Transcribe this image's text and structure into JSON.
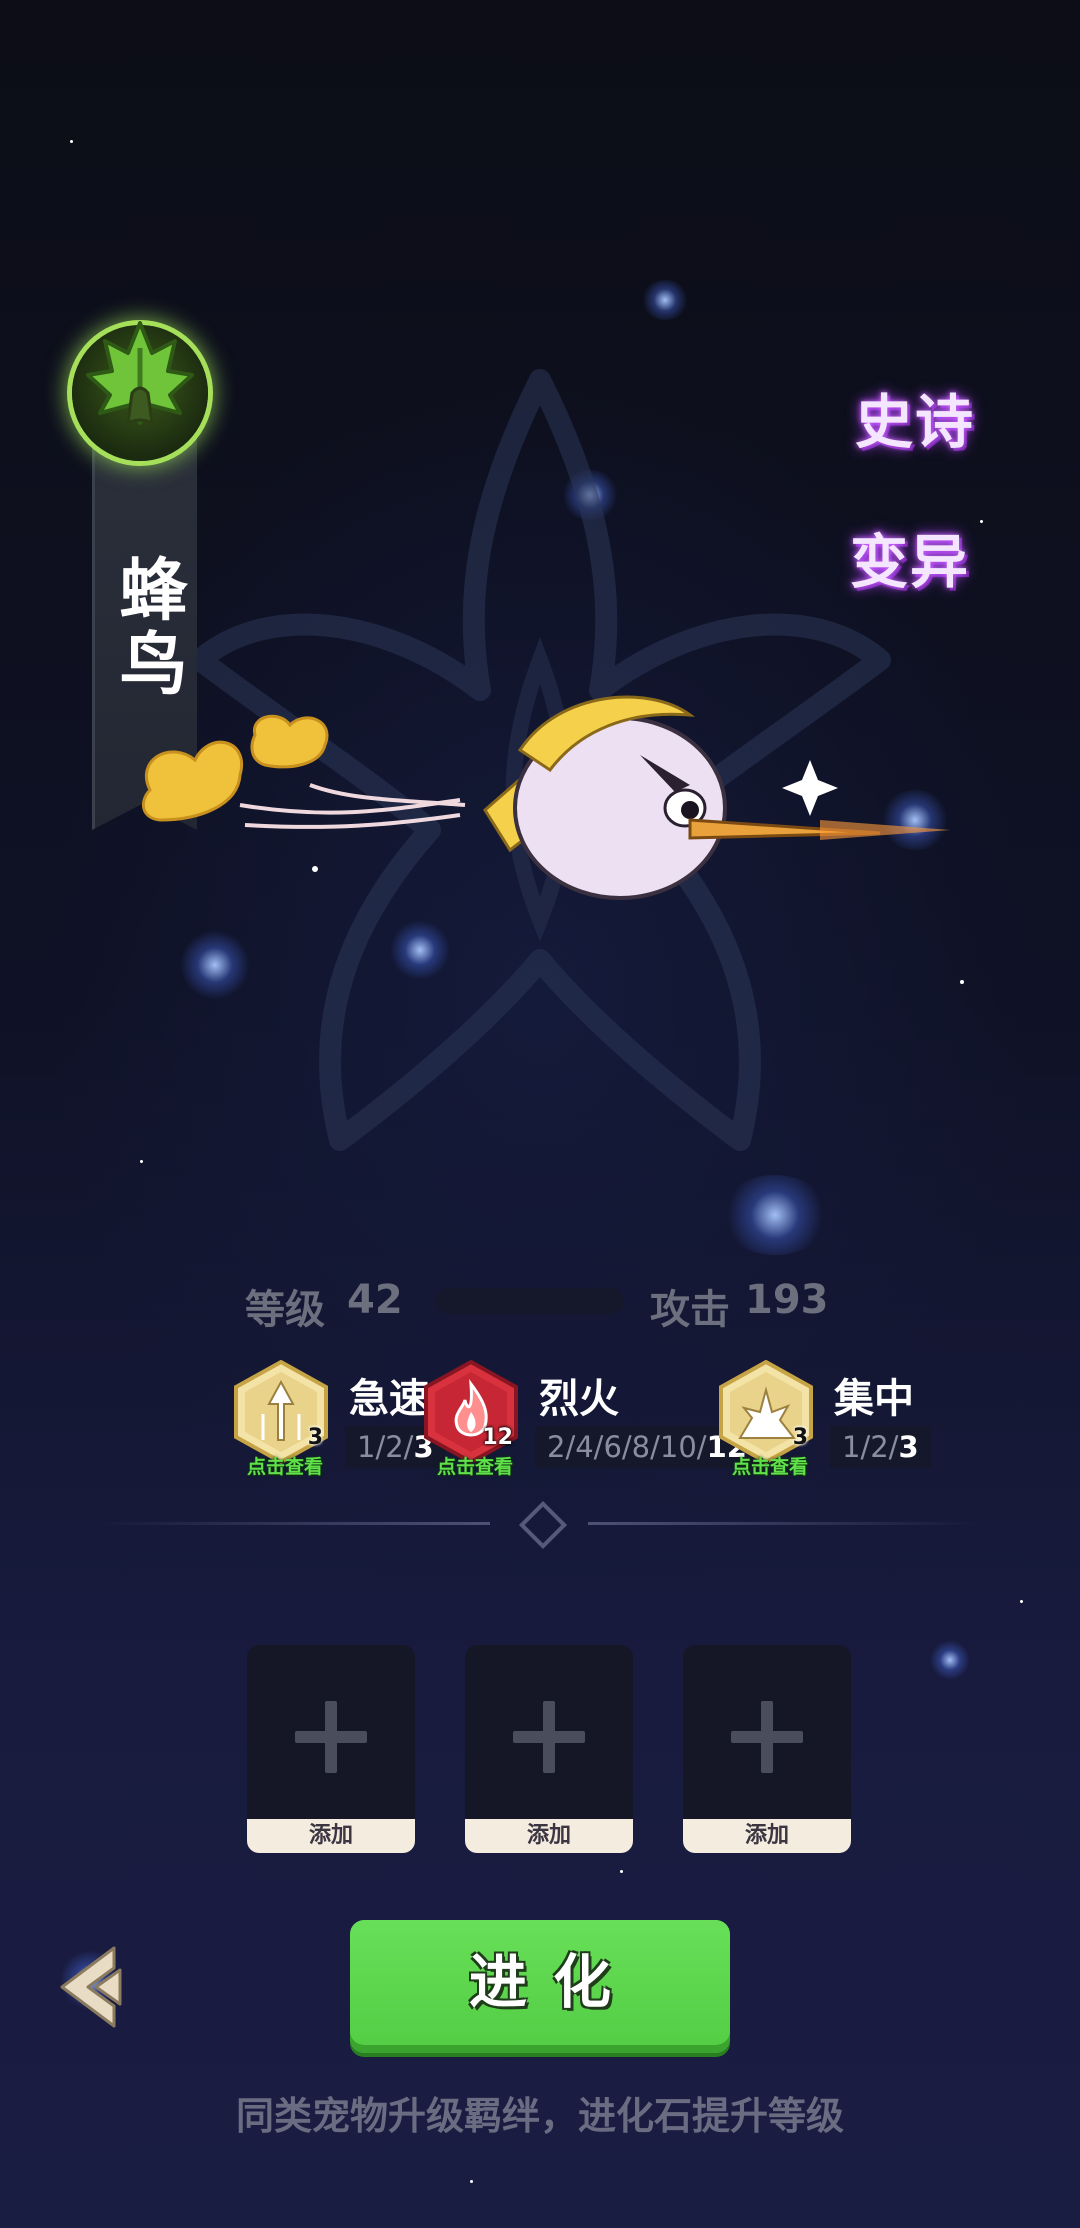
{
  "pet": {
    "name": "蜂鸟",
    "element_icon": "leaf-tree-icon",
    "rarity": "史诗",
    "variant": "变异"
  },
  "stats": {
    "level_label": "等级",
    "level_value": "42",
    "exp_progress": 0.0,
    "attack_label": "攻击",
    "attack_value": "193"
  },
  "skills": [
    {
      "name": "急速",
      "icon": "speed-arrow-icon",
      "level": "3",
      "view_hint": "点击查看",
      "tiers_prefix": "1/2/",
      "tiers_current": "3"
    },
    {
      "name": "烈火",
      "icon": "fire-icon",
      "level": "12",
      "view_hint": "点击查看",
      "tiers_prefix": "2/4/6/8/10/",
      "tiers_current": "12"
    },
    {
      "name": "集中",
      "icon": "burst-icon",
      "level": "3",
      "view_hint": "点击查看",
      "tiers_prefix": "1/2/",
      "tiers_current": "3"
    }
  ],
  "slots": [
    {
      "label": "添加"
    },
    {
      "label": "添加"
    },
    {
      "label": "添加"
    }
  ],
  "actions": {
    "evolve_label": "进化"
  },
  "hint": "同类宠物升级羁绊，进化石提升等级",
  "colors": {
    "evolve_button": "#5ad64b",
    "rarity_glow": "#b040ff",
    "element_ring": "#a6e05a",
    "hint_green": "#60e04a"
  }
}
